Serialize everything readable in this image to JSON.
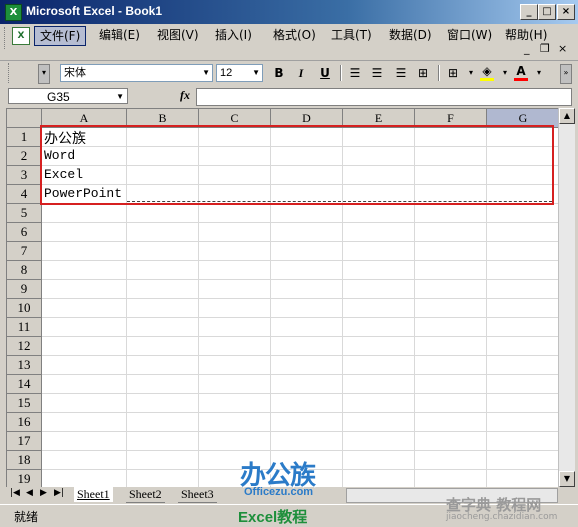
{
  "window": {
    "title": "Microsoft Excel - Book1"
  },
  "menu": {
    "items": [
      "文件(F)",
      "编辑(E)",
      "视图(V)",
      "插入(I)",
      "格式(O)",
      "工具(T)",
      "数据(D)",
      "窗口(W)",
      "帮助(H)"
    ],
    "active_index": 0
  },
  "toolbar": {
    "font_name": "宋体",
    "font_size": "12",
    "bold": "B",
    "italic": "I",
    "underline": "U",
    "font_color_label": "A",
    "highlight_color": "#ffff00",
    "font_color": "#ff0000"
  },
  "formula_bar": {
    "name_box": "G35",
    "fx_label": "fx",
    "formula": ""
  },
  "sheet": {
    "columns": [
      "A",
      "B",
      "C",
      "D",
      "E",
      "F",
      "G"
    ],
    "selected_column": "G",
    "rows": [
      "1",
      "2",
      "3",
      "4",
      "5",
      "6",
      "7",
      "8",
      "9",
      "10",
      "11",
      "12",
      "13",
      "14",
      "15",
      "16",
      "17",
      "18",
      "19"
    ],
    "cells": {
      "A1": "办公族",
      "A2": "Word",
      "A3": "Excel",
      "A4": "PowerPoint"
    }
  },
  "tabs": {
    "sheets": [
      "Sheet1",
      "Sheet2",
      "Sheet3"
    ],
    "active": "Sheet1"
  },
  "status": {
    "text": "就绪"
  },
  "watermarks": {
    "logo": "办公族",
    "url": "Officezu.com",
    "caption": "Excel教程",
    "corner": "查字典 教程网",
    "corner_url": "jiaocheng.chazidian.com"
  },
  "colors": {
    "title_bar": "#0a246a",
    "highlight_box": "#d62020"
  }
}
